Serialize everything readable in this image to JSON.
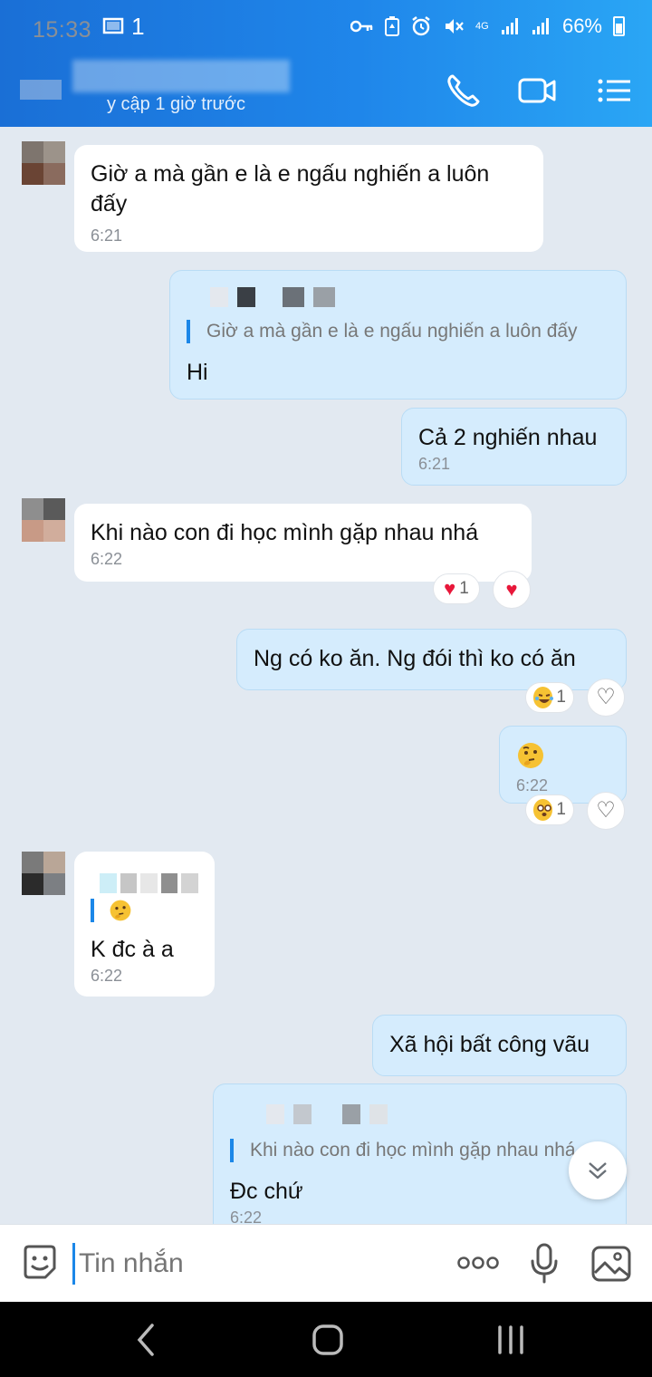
{
  "status": {
    "time": "15:33",
    "notif": "1",
    "signal_label": "4G",
    "battery": "66%"
  },
  "header": {
    "subtitle": "y cập 1 giờ trước"
  },
  "messages": [
    {
      "id": "m1",
      "text": "Giờ a mà gần e là e ngấu nghiến a luôn đấy",
      "time": "6:21"
    },
    {
      "id": "m2",
      "quote": "Giờ a mà gần e là e ngấu nghiến a luôn đấy",
      "text": "Hi"
    },
    {
      "id": "m3",
      "text": "Cả 2 nghiến nhau",
      "time": "6:21"
    },
    {
      "id": "m4",
      "text": "Khi nào con đi học mình gặp nhau nhá",
      "time": "6:22",
      "reaction_count": "1"
    },
    {
      "id": "m5",
      "text": "Ng có ko ăn. Ng đói thì ko có ăn",
      "reaction_count": "1"
    },
    {
      "id": "m6",
      "emoji": "thinking-face",
      "time": "6:22",
      "reaction_count": "1"
    },
    {
      "id": "m7",
      "quote_emoji": "thinking-face",
      "text": "K đc à a",
      "time": "6:22"
    },
    {
      "id": "m8",
      "text": "Xã hội bất công vãu"
    },
    {
      "id": "m9",
      "quote": "Khi nào con đi học mình gặp nhau nhá",
      "text": "Đc chứ",
      "time": "6:22"
    }
  ],
  "input": {
    "placeholder": "Tin nhắn"
  },
  "colors": {
    "accent": "#1b87e8",
    "header_start": "#1a6fd6",
    "header_end": "#2aa6f5",
    "chat_bg": "#e2e9f1",
    "outgoing_bubble": "#d5ecfd"
  }
}
